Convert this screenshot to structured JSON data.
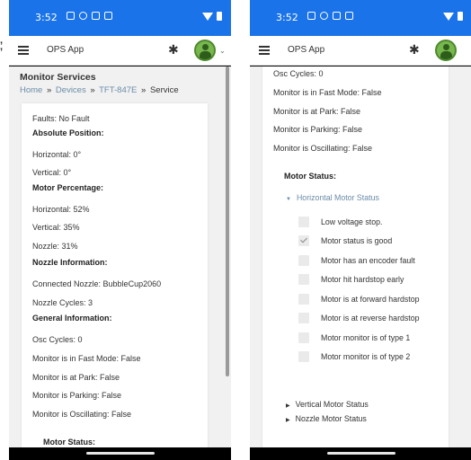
{
  "status_bar": {
    "time": "3:52"
  },
  "app_bar": {
    "title": "OPS App"
  },
  "edge_text": ",\n,",
  "left": {
    "page_title": "Monitor Services",
    "breadcrumb": [
      "Home",
      "Devices",
      "TFT-847E",
      "Service"
    ],
    "breadcrumb_sep": "»",
    "lines": [
      {
        "text": "Faults: No Fault",
        "heading": false
      },
      {
        "text": "Absolute Position:",
        "heading": true
      },
      {
        "text": "Horizontal: 0°",
        "heading": false
      },
      {
        "text": "Vertical: 0°",
        "heading": false
      },
      {
        "text": "Motor Percentage:",
        "heading": true
      },
      {
        "text": "Horizontal: 52%",
        "heading": false
      },
      {
        "text": "Vertical: 35%",
        "heading": false
      },
      {
        "text": "Nozzle: 31%",
        "heading": false
      },
      {
        "text": "Nozzle Information:",
        "heading": true
      },
      {
        "text": "Connected Nozzle: BubbleCup2060",
        "heading": false
      },
      {
        "text": "Nozzle Cycles: 3",
        "heading": false
      },
      {
        "text": "General Information:",
        "heading": true
      },
      {
        "text": "Osc Cycles: 0",
        "heading": false
      },
      {
        "text": "Monitor is in Fast Mode: False",
        "heading": false
      },
      {
        "text": "Monitor is at Park: False",
        "heading": false
      },
      {
        "text": "Monitor is Parking: False",
        "heading": false
      },
      {
        "text": "Monitor is Oscillating: False",
        "heading": false
      },
      {
        "text": "Motor Status:",
        "heading": true
      }
    ]
  },
  "right": {
    "lines": [
      "Osc Cycles: 0",
      "Monitor is in Fast Mode: False",
      "Monitor is at Park: False",
      "Monitor is Parking: False",
      "Monitor is Oscillating: False"
    ],
    "motor_status_heading": "Motor Status:",
    "horizontal_header": "Horizontal Motor Status",
    "horizontal_items": [
      {
        "label": "Low voltage stop.",
        "checked": false
      },
      {
        "label": "Motor status is good",
        "checked": true
      },
      {
        "label": "Motor has an encoder fault",
        "checked": false
      },
      {
        "label": "Motor hit hardstop early",
        "checked": false
      },
      {
        "label": "Motor is at forward hardstop",
        "checked": false
      },
      {
        "label": "Motor is at reverse hardstop",
        "checked": false
      },
      {
        "label": "Motor monitor is of type 1",
        "checked": false
      },
      {
        "label": "Motor monitor is of type 2",
        "checked": false
      }
    ],
    "vertical_header": "Vertical Motor Status",
    "nozzle_header": "Nozzle Motor Status"
  },
  "colors": {
    "status_bar": "#1a73e8",
    "link": "#6a8ca8",
    "background": "#f1f1f1"
  },
  "icons": {
    "menu": "hamburger-icon",
    "bluetooth": "bluetooth-icon",
    "avatar": "avatar-icon"
  }
}
